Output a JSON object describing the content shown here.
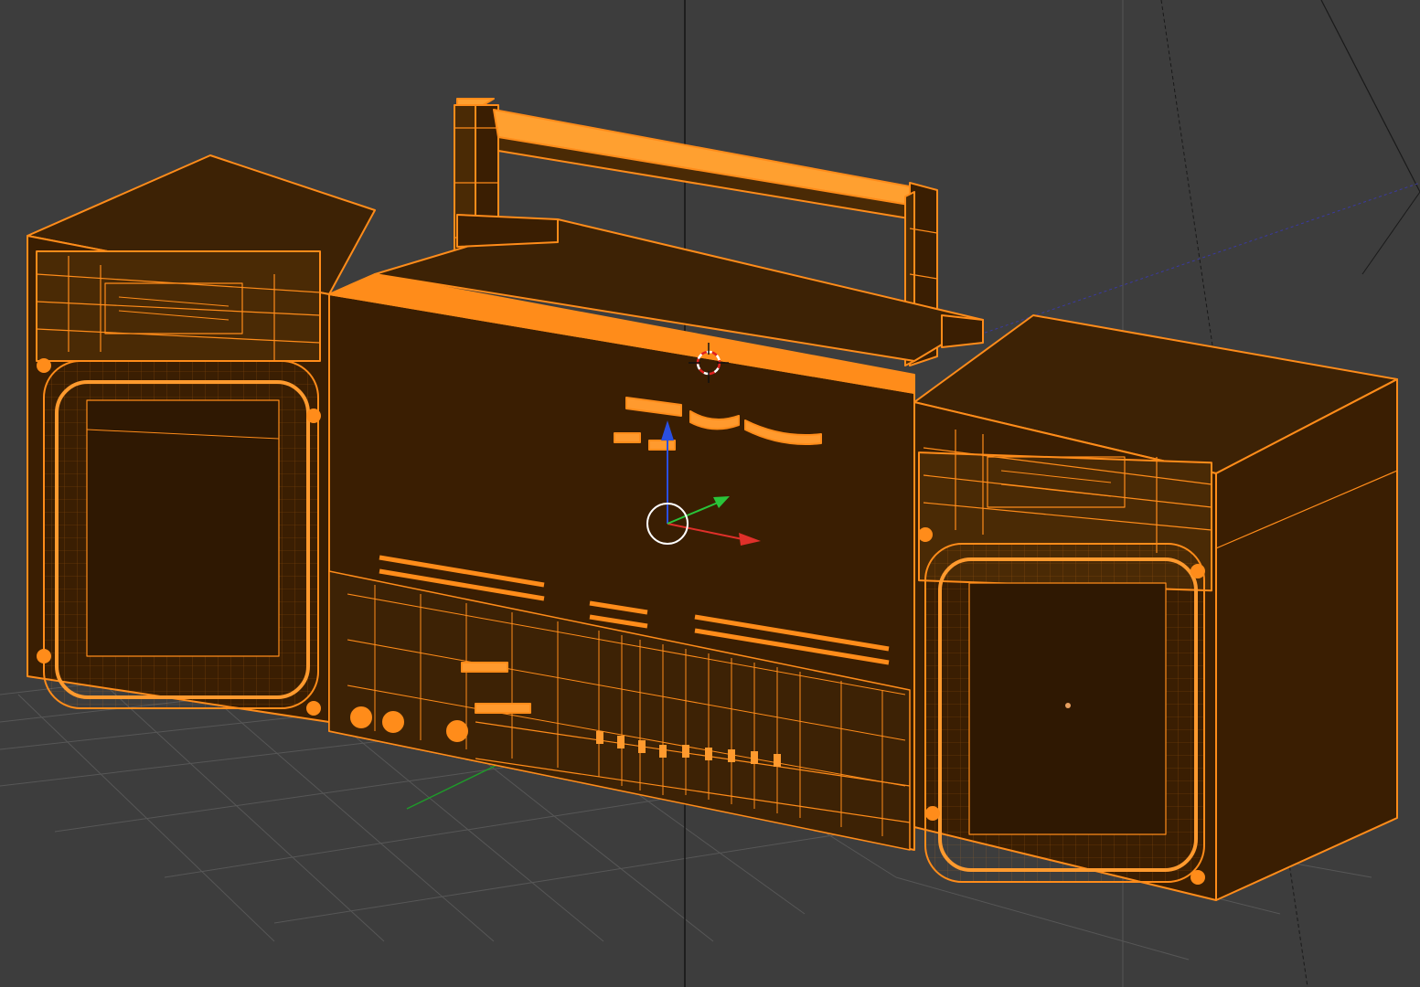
{
  "viewport": {
    "mode": "3d-viewport-wireframe-selected",
    "background_color": "#3d3d3d",
    "grid_color": "#5a5a5a",
    "selection_color": "#ff8c1a",
    "object_fill_color": "#3a1e02",
    "face_color_dark": "#4a2a05"
  },
  "object": {
    "name_icon": "boombox-mesh",
    "state": "selected"
  },
  "gizmo": {
    "x_axis_color": "#e0302a",
    "y_axis_color": "#29c43a",
    "z_axis_color": "#2a4fe0",
    "center_ring_color": "#ffffff"
  },
  "cursor_3d": {
    "icon": "3d-cursor-icon",
    "ring_color_a": "#e02020",
    "ring_color_b": "#ffffff"
  }
}
